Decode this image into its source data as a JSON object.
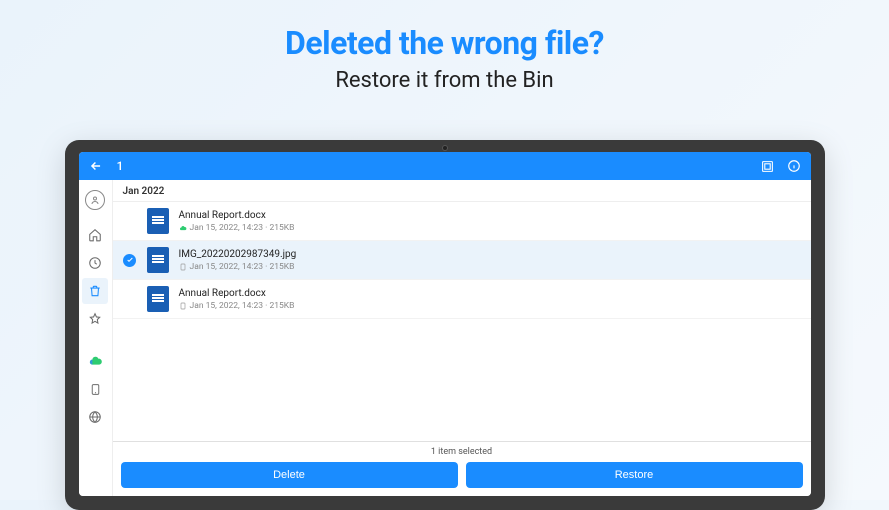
{
  "hero": {
    "title": "Deleted the wrong file?",
    "subtitle": "Restore it from the Bin"
  },
  "topbar": {
    "selected_count": "1"
  },
  "section": {
    "header": "Jan 2022"
  },
  "files": [
    {
      "name": "Annual Report.docx",
      "meta": "Jan 15, 2022, 14:23 · 215KB",
      "location": "cloud",
      "selected": false
    },
    {
      "name": "IMG_20220202987349.jpg",
      "meta": "Jan 15, 2022, 14:23 · 215KB",
      "location": "device",
      "selected": true
    },
    {
      "name": "Annual Report.docx",
      "meta": "Jan 15, 2022, 14:23 · 215KB",
      "location": "device",
      "selected": false
    }
  ],
  "bottom": {
    "count_label": "1 item selected",
    "delete_label": "Delete",
    "restore_label": "Restore"
  }
}
